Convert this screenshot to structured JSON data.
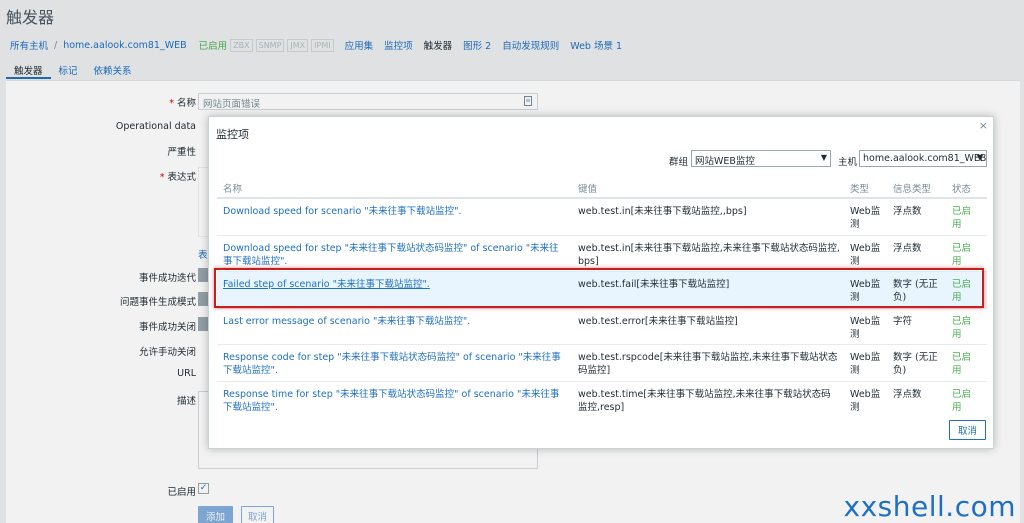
{
  "page_title": "触发器",
  "breadcrumb": {
    "all_hosts": "所有主机",
    "separator": "/",
    "host": "home.aalook.com81_WEB",
    "enabled": "已启用",
    "tags": [
      "ZBX",
      "SNMP",
      "JMX",
      "IPMI"
    ],
    "nav": [
      "应用集",
      "监控项",
      "触发器",
      "图形 2",
      "自动发现规则",
      "Web 场景 1"
    ]
  },
  "tabs": [
    "触发器",
    "标记",
    "依赖关系"
  ],
  "form": {
    "name_label": "名称",
    "name_value": "网站页面错误",
    "operational_label": "Operational data",
    "severity_label": "严重性",
    "expression_label": "表达式",
    "link_partial": "表",
    "event_ok_label": "事件成功迭代",
    "problem_mode_label": "问题事件生成模式",
    "event_ok_close_label": "事件成功关闭",
    "manual_close_label": "允许手动关闭",
    "url_label": "URL",
    "description_label": "描述",
    "enabled_label": "已启用",
    "enabled_check": "✓",
    "add_button": "添加",
    "cancel_button": "取消"
  },
  "modal": {
    "title": "监控项",
    "close": "×",
    "group_label": "群组",
    "group_value": "网站WEB监控",
    "host_label": "主机",
    "host_value": "home.aalook.com81_WEB",
    "columns": {
      "name": "名称",
      "key": "键值",
      "type": "类型",
      "info_type": "信息类型",
      "status": "状态"
    },
    "rows": [
      {
        "name": "Download speed for scenario \"未来往事下载站监控\".",
        "key": "web.test.in[未来往事下载站监控,,bps]",
        "type": "Web监测",
        "info_type": "浮点数",
        "status": "已启用"
      },
      {
        "name": "Download speed for step \"未来往事下载站状态码监控\" of scenario \"未来往事下载站监控\".",
        "key": "web.test.in[未来往事下载站监控,未来往事下载站状态码监控,bps]",
        "type": "Web监测",
        "info_type": "浮点数",
        "status": "已启用"
      },
      {
        "name": "Failed step of scenario \"未来往事下载站监控\".",
        "key": "web.test.fail[未来往事下载站监控]",
        "type": "Web监测",
        "info_type": "数字 (无正负)",
        "status": "已启用"
      },
      {
        "name": "Last error message of scenario \"未来往事下载站监控\".",
        "key": "web.test.error[未来往事下载站监控]",
        "type": "Web监测",
        "info_type": "字符",
        "status": "已启用"
      },
      {
        "name": "Response code for step \"未来往事下载站状态码监控\" of scenario \"未来往事下载站监控\".",
        "key": "web.test.rspcode[未来往事下载站监控,未来往事下载站状态码监控]",
        "type": "Web监测",
        "info_type": "数字 (无正负)",
        "status": "已启用"
      },
      {
        "name": "Response time for step \"未来往事下载站状态码监控\" of scenario \"未来往事下载站监控\".",
        "key": "web.test.time[未来往事下载站监控,未来往事下载站状态码监控,resp]",
        "type": "Web监测",
        "info_type": "浮点数",
        "status": "已启用"
      }
    ],
    "cancel": "取消"
  },
  "watermark": "xxshell.com",
  "colors": {
    "accent": "#1f6fc3",
    "enabled": "#4caf50",
    "highlight": "#c81e1e"
  }
}
